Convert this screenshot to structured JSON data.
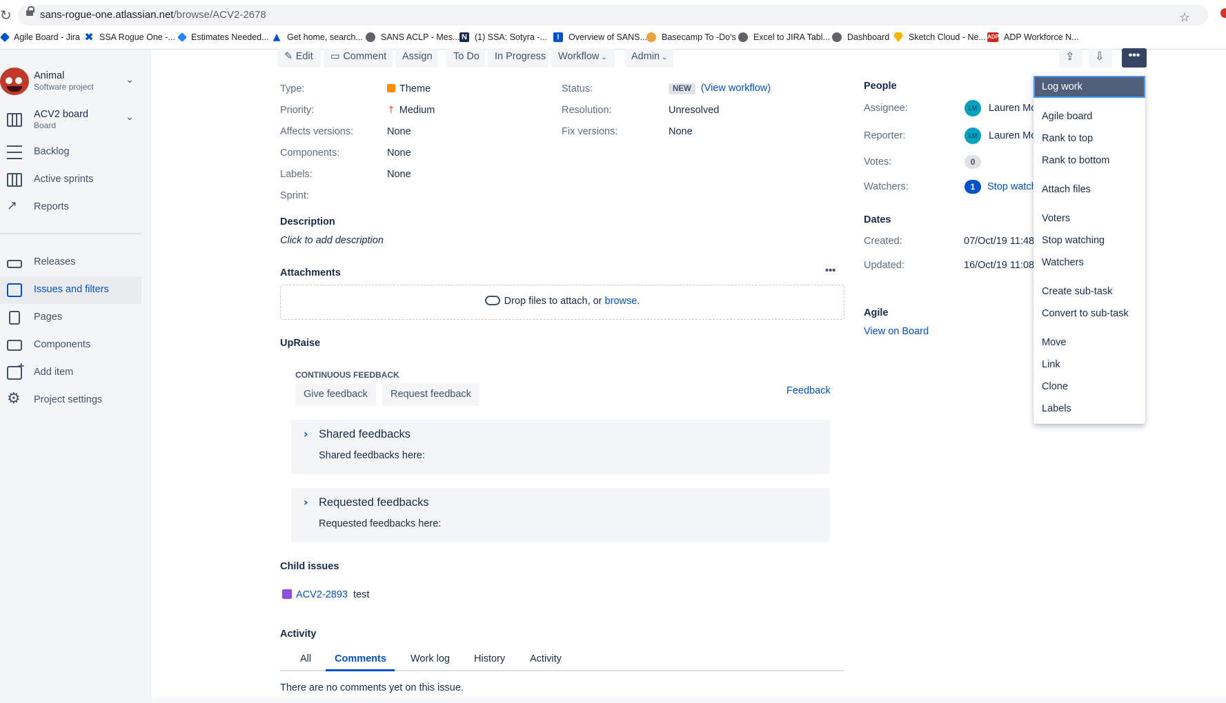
{
  "browser": {
    "url_host": "sans-rogue-one.atlassian.net",
    "url_path": "/browse/ACV2-2678",
    "bookmarks": [
      {
        "label": "Agile Board - Jira",
        "icon": "jira-icon",
        "color": "#0052cc"
      },
      {
        "label": "SSA Rogue One -...",
        "icon": "confluence-icon",
        "color": "#0052cc"
      },
      {
        "label": "Estimates Needed...",
        "icon": "jira-icon",
        "color": "#0052cc"
      },
      {
        "label": "Get home, search...",
        "icon": "atlassian-icon",
        "color": "#0052cc"
      },
      {
        "label": "SANS ACLP - Mes...",
        "icon": "globe-icon",
        "color": "#5f6368"
      },
      {
        "label": "(1) SSA: Sotyra -...",
        "icon": "sotyra-icon",
        "color": "#172b4d"
      },
      {
        "label": "Overview of SANS...",
        "icon": "info-icon",
        "color": "#0052cc"
      },
      {
        "label": "Basecamp To -Do's",
        "icon": "basecamp-icon",
        "color": "#e8a33d"
      },
      {
        "label": "Excel to JIRA Tabl...",
        "icon": "globe-icon",
        "color": "#5f6368"
      },
      {
        "label": "Dashboard",
        "icon": "globe-icon",
        "color": "#5f6368"
      },
      {
        "label": "Sketch Cloud - Ne...",
        "icon": "sketch-icon",
        "color": "#f7b500"
      },
      {
        "label": "ADP Workforce N...",
        "icon": "adp-icon",
        "color": "#d0271d"
      }
    ]
  },
  "sidebar": {
    "project_name": "Animal",
    "project_type": "Software project",
    "board_name": "ACV2 board",
    "board_type": "Board",
    "items": [
      {
        "label": "Backlog",
        "icon": "backlog-icon"
      },
      {
        "label": "Active sprints",
        "icon": "board-icon"
      },
      {
        "label": "Reports",
        "icon": "reports-icon"
      },
      {
        "label": "Releases",
        "icon": "ship-icon"
      },
      {
        "label": "Issues and filters",
        "icon": "issues-icon",
        "active": true
      },
      {
        "label": "Pages",
        "icon": "page-icon"
      },
      {
        "label": "Components",
        "icon": "component-icon"
      },
      {
        "label": "Add item",
        "icon": "add-item-icon"
      },
      {
        "label": "Project settings",
        "icon": "gear-icon"
      }
    ]
  },
  "toolbar": {
    "edit": "Edit",
    "comment": "Comment",
    "assign": "Assign",
    "todo": "To Do",
    "in_progress": "In Progress",
    "workflow": "Workflow",
    "admin": "Admin",
    "more": "•••"
  },
  "details": {
    "type_label": "Type:",
    "type_value": "Theme",
    "priority_label": "Priority:",
    "priority_value": "Medium",
    "affects_label": "Affects versions:",
    "affects_value": "None",
    "components_label": "Components:",
    "components_value": "None",
    "labels_label": "Labels:",
    "labels_value": "None",
    "sprint_label": "Sprint:",
    "status_label": "Status:",
    "status_value": "NEW",
    "view_workflow": "(View workflow)",
    "resolution_label": "Resolution:",
    "resolution_value": "Unresolved",
    "fix_label": "Fix versions:",
    "fix_value": "None"
  },
  "description": {
    "heading": "Description",
    "placeholder": "Click to add description"
  },
  "attachments": {
    "heading": "Attachments",
    "drop_text": "Drop files to attach, or ",
    "browse": "browse",
    "dots": "•••"
  },
  "upraise": {
    "heading": "UpRaise",
    "section": "CONTINUOUS FEEDBACK",
    "give": "Give feedback",
    "request": "Request feedback",
    "feedback_link": "Feedback",
    "shared_title": "Shared feedbacks",
    "shared_body": "Shared feedbacks here:",
    "requested_title": "Requested feedbacks",
    "requested_body": "Requested feedbacks here:"
  },
  "child_issues": {
    "heading": "Child issues",
    "key": "ACV2-2893",
    "summary": "test"
  },
  "activity": {
    "heading": "Activity",
    "tabs": [
      "All",
      "Comments",
      "Work log",
      "History",
      "Activity"
    ],
    "active_tab": "Comments",
    "empty": "There are no comments yet on this issue."
  },
  "people": {
    "heading": "People",
    "assignee_label": "Assignee:",
    "assignee": "Lauren Mc",
    "reporter_label": "Reporter:",
    "reporter": "Lauren Mc",
    "initials": "LM",
    "votes_label": "Votes:",
    "votes": "0",
    "watchers_label": "Watchers:",
    "watchers": "1",
    "stop_watching": "Stop watch"
  },
  "dates": {
    "heading": "Dates",
    "created_label": "Created:",
    "created": "07/Oct/19 11:48",
    "updated_label": "Updated:",
    "updated": "16/Oct/19 11:08"
  },
  "agile": {
    "heading": "Agile",
    "view_on_board": "View on Board"
  },
  "menu": {
    "items": [
      "Log work",
      "Agile board",
      "Rank to top",
      "Rank to bottom",
      "Attach files",
      "Voters",
      "Stop watching",
      "Watchers",
      "Create sub-task",
      "Convert to sub-task",
      "Move",
      "Link",
      "Clone",
      "Labels"
    ],
    "selected": "Log work"
  }
}
